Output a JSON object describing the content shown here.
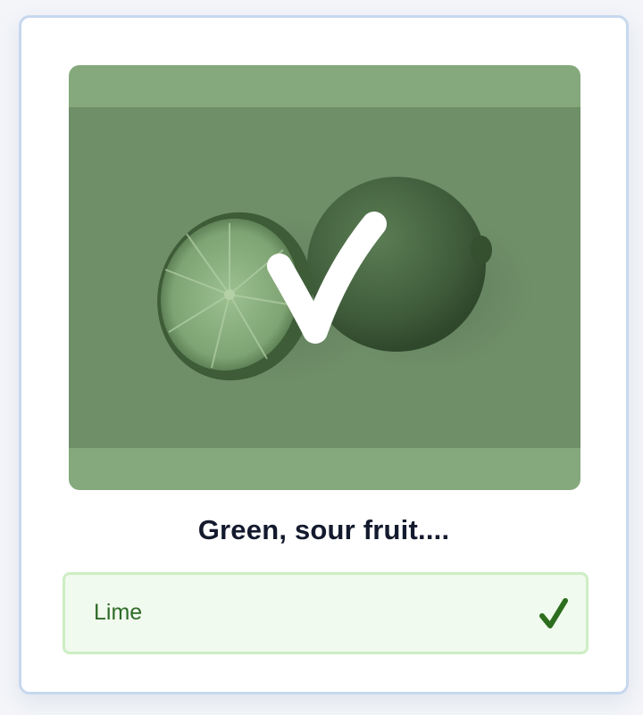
{
  "card": {
    "question": "Green, sour fruit....",
    "image_icon": "lime-photo",
    "overlay_icon": "checkmark-icon"
  },
  "answer": {
    "label": "Lime",
    "status_icon": "checkmark-icon",
    "state": "correct"
  },
  "colors": {
    "image_tint": "#85a97c",
    "answer_bg": "#f1faee",
    "answer_border": "#cdeec4",
    "answer_text": "#2e6b27",
    "check": "#2d6e1e"
  }
}
